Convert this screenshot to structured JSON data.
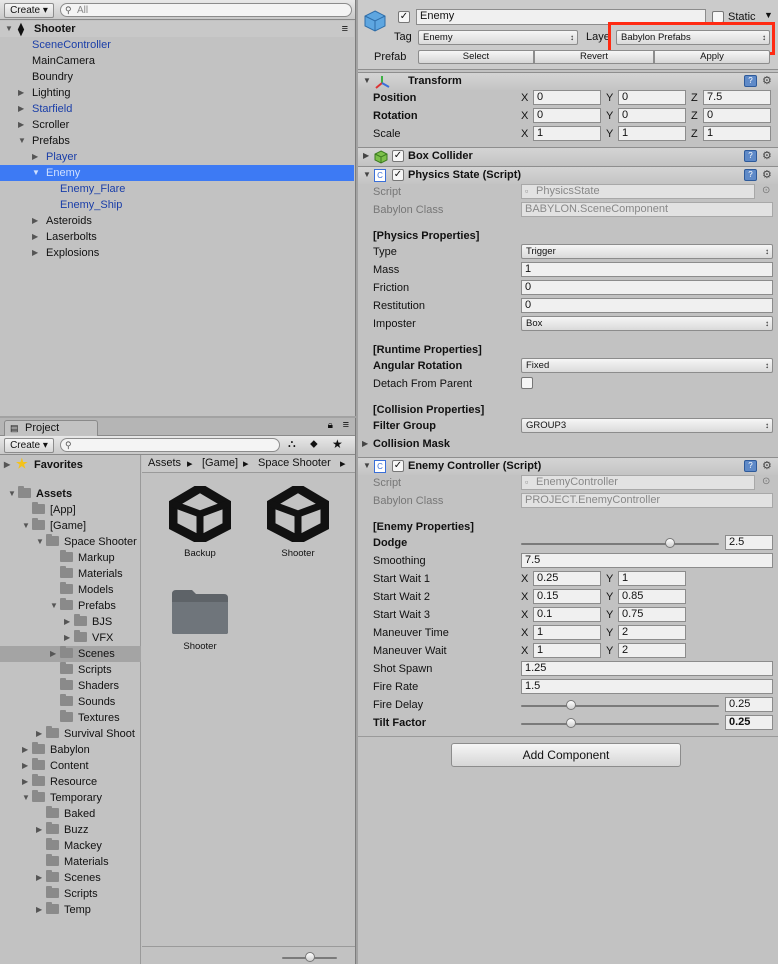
{
  "hierarchy": {
    "create_label": "Create",
    "search_placeholder": "All",
    "scene_name": "Shooter",
    "items": [
      {
        "label": "SceneController",
        "depth": 1,
        "color": "blue",
        "arrow": ""
      },
      {
        "label": "MainCamera",
        "depth": 1,
        "color": "black",
        "arrow": ""
      },
      {
        "label": "Boundry",
        "depth": 1,
        "color": "black",
        "arrow": ""
      },
      {
        "label": "Lighting",
        "depth": 1,
        "color": "black",
        "arrow": "right"
      },
      {
        "label": "Starfield",
        "depth": 1,
        "color": "blue",
        "arrow": "right"
      },
      {
        "label": "Scroller",
        "depth": 1,
        "color": "black",
        "arrow": "right"
      },
      {
        "label": "Prefabs",
        "depth": 1,
        "color": "black",
        "arrow": "down"
      },
      {
        "label": "Player",
        "depth": 2,
        "color": "blue",
        "arrow": "right"
      },
      {
        "label": "Enemy",
        "depth": 2,
        "color": "selected",
        "arrow": "down"
      },
      {
        "label": "Enemy_Flare",
        "depth": 3,
        "color": "blue",
        "arrow": ""
      },
      {
        "label": "Enemy_Ship",
        "depth": 3,
        "color": "blue",
        "arrow": ""
      },
      {
        "label": "Asteroids",
        "depth": 2,
        "color": "black",
        "arrow": "right"
      },
      {
        "label": "Laserbolts",
        "depth": 2,
        "color": "black",
        "arrow": "right"
      },
      {
        "label": "Explosions",
        "depth": 2,
        "color": "black",
        "arrow": "right"
      }
    ]
  },
  "project": {
    "tab_label": "Project",
    "create_label": "Create",
    "favorites_label": "Favorites",
    "breadcrumb": [
      "Assets",
      "[Game]",
      "Space Shooter"
    ],
    "tree": [
      {
        "label": "Assets",
        "indent": 0,
        "arrow": "down",
        "bold": true
      },
      {
        "label": "[App]",
        "indent": 1,
        "arrow": ""
      },
      {
        "label": "[Game]",
        "indent": 1,
        "arrow": "down"
      },
      {
        "label": "Space Shooter",
        "indent": 2,
        "arrow": "down"
      },
      {
        "label": "Markup",
        "indent": 3,
        "arrow": ""
      },
      {
        "label": "Materials",
        "indent": 3,
        "arrow": ""
      },
      {
        "label": "Models",
        "indent": 3,
        "arrow": ""
      },
      {
        "label": "Prefabs",
        "indent": 3,
        "arrow": "down"
      },
      {
        "label": "BJS",
        "indent": 4,
        "arrow": "right"
      },
      {
        "label": "VFX",
        "indent": 4,
        "arrow": "right"
      },
      {
        "label": "Scenes",
        "indent": 3,
        "arrow": "right",
        "selected": true
      },
      {
        "label": "Scripts",
        "indent": 3,
        "arrow": ""
      },
      {
        "label": "Shaders",
        "indent": 3,
        "arrow": ""
      },
      {
        "label": "Sounds",
        "indent": 3,
        "arrow": ""
      },
      {
        "label": "Textures",
        "indent": 3,
        "arrow": ""
      },
      {
        "label": "Survival Shoot",
        "indent": 2,
        "arrow": "right"
      },
      {
        "label": "Babylon",
        "indent": 1,
        "arrow": "right"
      },
      {
        "label": "Content",
        "indent": 1,
        "arrow": "right"
      },
      {
        "label": "Resource",
        "indent": 1,
        "arrow": "right"
      },
      {
        "label": "Temporary",
        "indent": 1,
        "arrow": "down"
      },
      {
        "label": "Baked",
        "indent": 2,
        "arrow": ""
      },
      {
        "label": "Buzz",
        "indent": 2,
        "arrow": "right"
      },
      {
        "label": "Mackey",
        "indent": 2,
        "arrow": ""
      },
      {
        "label": "Materials",
        "indent": 2,
        "arrow": ""
      },
      {
        "label": "Scenes",
        "indent": 2,
        "arrow": "right"
      },
      {
        "label": "Scripts",
        "indent": 2,
        "arrow": ""
      },
      {
        "label": "Temp",
        "indent": 2,
        "arrow": "right"
      }
    ],
    "assets": [
      {
        "label": "Backup",
        "kind": "unity"
      },
      {
        "label": "Shooter",
        "kind": "unity"
      },
      {
        "label": "Shooter",
        "kind": "folder"
      }
    ],
    "zoom_level": 0.5
  },
  "inspector": {
    "object_name": "Enemy",
    "static_label": "Static",
    "tag_label": "Tag",
    "tag_value": "Enemy",
    "layer_label": "Laye",
    "layer_value": "Babylon Prefabs",
    "prefab_label": "Prefab",
    "prefab_buttons": [
      "Select",
      "Revert",
      "Apply"
    ],
    "highlight_color": "#ff2a12",
    "transform": {
      "title": "Transform",
      "rows": [
        {
          "label": "Position",
          "x": "0",
          "y": "0",
          "z": "7.5"
        },
        {
          "label": "Rotation",
          "x": "0",
          "y": "0",
          "z": "0"
        },
        {
          "label": "Scale",
          "x": "1",
          "y": "1",
          "z": "1"
        }
      ]
    },
    "box_collider": {
      "title": "Box Collider"
    },
    "physics": {
      "title": "Physics State (Script)",
      "script_label": "Script",
      "script_value": "PhysicsState",
      "class_label": "Babylon Class",
      "class_value": "BABYLON.SceneComponent",
      "section1": "[Physics Properties]",
      "type_label": "Type",
      "type_value": "Trigger",
      "mass_label": "Mass",
      "mass_value": "1",
      "friction_label": "Friction",
      "friction_value": "0",
      "restitution_label": "Restitution",
      "restitution_value": "0",
      "imposter_label": "Imposter",
      "imposter_value": "Box",
      "section2": "[Runtime Properties]",
      "angular_label": "Angular Rotation",
      "angular_value": "Fixed",
      "detach_label": "Detach From Parent",
      "section3": "[Collision Properties]",
      "filter_label": "Filter Group",
      "filter_value": "GROUP3",
      "mask_label": "Collision Mask"
    },
    "enemy": {
      "title": "Enemy Controller (Script)",
      "script_label": "Script",
      "script_value": "EnemyController",
      "class_label": "Babylon Class",
      "class_value": "PROJECT.EnemyController",
      "section": "[Enemy Properties]",
      "dodge_label": "Dodge",
      "dodge_value": "2.5",
      "dodge_fraction": 0.75,
      "smoothing_label": "Smoothing",
      "smoothing_value": "7.5",
      "start_wait_1_label": "Start Wait 1",
      "start_wait_1_x": "0.25",
      "start_wait_1_y": "1",
      "start_wait_2_label": "Start Wait 2",
      "start_wait_2_x": "0.15",
      "start_wait_2_y": "0.85",
      "start_wait_3_label": "Start Wait 3",
      "start_wait_3_x": "0.1",
      "start_wait_3_y": "0.75",
      "maneuver_time_label": "Maneuver Time",
      "maneuver_time_x": "1",
      "maneuver_time_y": "2",
      "maneuver_wait_label": "Maneuver Wait",
      "maneuver_wait_x": "1",
      "maneuver_wait_y": "2",
      "shot_spawn_label": "Shot Spawn",
      "shot_spawn_value": "1.25",
      "fire_rate_label": "Fire Rate",
      "fire_rate_value": "1.5",
      "fire_delay_label": "Fire Delay",
      "fire_delay_value": "0.25",
      "fire_delay_fraction": 0.25,
      "tilt_label": "Tilt Factor",
      "tilt_value": "0.25",
      "tilt_fraction": 0.25
    },
    "add_component_label": "Add Component",
    "axis_labels": {
      "x": "X",
      "y": "Y",
      "z": "Z"
    }
  }
}
